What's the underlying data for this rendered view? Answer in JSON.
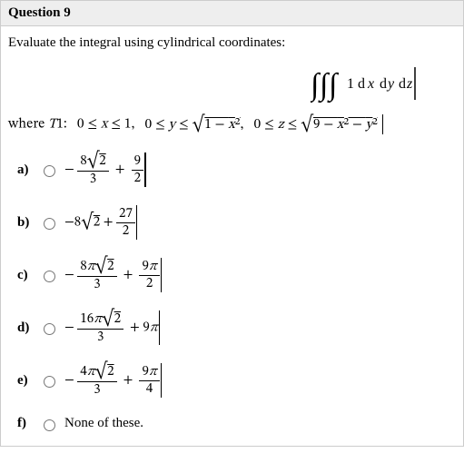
{
  "question": {
    "number_label": "Question 9",
    "prompt": "Evaluate the integral using cylindrical coordinates:",
    "integral_text": "∭ 1 dx dy dz",
    "where_prefix": "where ",
    "region_name": "T1:",
    "bounds1": "0 ≤ x ≤ 1,",
    "bounds2": "0 ≤ y ≤ √(1 − x²),",
    "bounds3": "0 ≤ z ≤ √(9 − x² − y²)"
  },
  "options": {
    "a": {
      "label": "a)",
      "expr_parts": [
        "−",
        "8√2",
        "3",
        "+",
        "9",
        "2"
      ],
      "cursor_h": 42
    },
    "b": {
      "label": "b)",
      "expr_parts": [
        "−8√2 +",
        "27",
        "2"
      ],
      "cursor_h": 42
    },
    "c": {
      "label": "c)",
      "expr_parts": [
        "−",
        "8π√2",
        "3",
        "+",
        "9π",
        "2"
      ],
      "cursor_h": 42
    },
    "d": {
      "label": "d)",
      "expr_parts": [
        "−",
        "16π√2",
        "3",
        "+ 9π"
      ],
      "cursor_h": 42
    },
    "e": {
      "label": "e)",
      "expr_parts": [
        "−",
        "4π√2",
        "3",
        "+",
        "9π",
        "4"
      ],
      "cursor_h": 42
    },
    "f": {
      "label": "f)",
      "text": "None of these."
    }
  }
}
